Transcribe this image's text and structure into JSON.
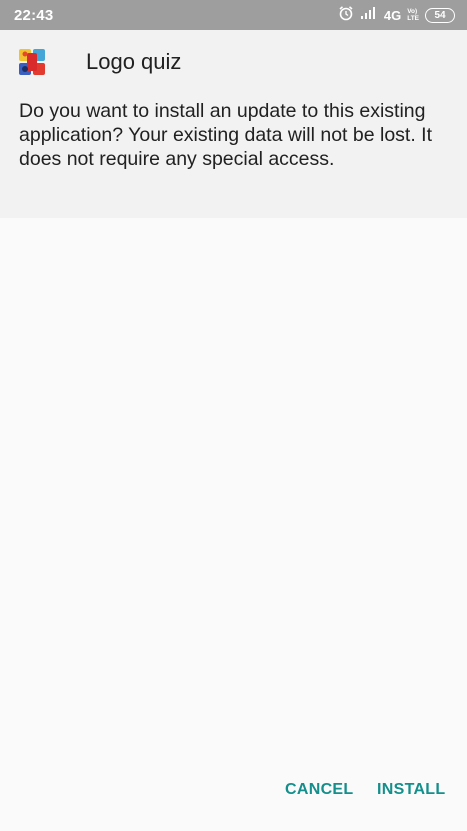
{
  "status_bar": {
    "time": "22:43",
    "network": "4G",
    "volte_top": "Vo)",
    "volte_bottom": "LTE",
    "battery": "54",
    "icons": [
      "alarm-icon",
      "signal-icon"
    ]
  },
  "app": {
    "name": "Logo quiz",
    "message": "Do you want to install an update to this existing application? Your existing data will not be lost. It does not require any special access."
  },
  "actions": {
    "cancel_label": "CANCEL",
    "install_label": "INSTALL"
  },
  "colors": {
    "status_bar": "#9e9e9e",
    "header_panel": "#f2f2f2",
    "background": "#fafafa",
    "accent": "#148f8c"
  }
}
